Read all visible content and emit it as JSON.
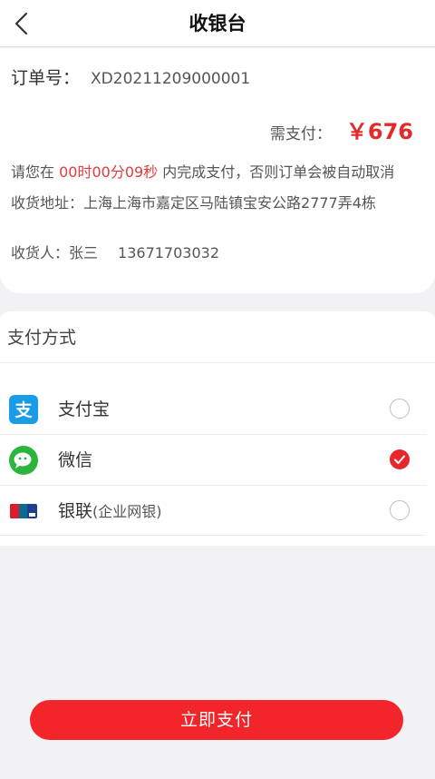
{
  "header": {
    "title": "收银台",
    "back_icon": "chevron-left-icon"
  },
  "order": {
    "number_label": "订单号：",
    "number": "XD20211209000001",
    "need_pay_label": "需支付：",
    "amount": "￥676",
    "deadline_prefix": "请您在 ",
    "countdown": "00时00分09秒",
    "deadline_suffix": " 内完成支付，否则订单会被自动取消",
    "address_label": "收货地址：",
    "address": "上海上海市嘉定区马陆镇宝安公路2777弄4栋",
    "receiver_label": "收货人：",
    "receiver_name": "张三",
    "receiver_phone": "13671703032"
  },
  "payment": {
    "title": "支付方式",
    "options": [
      {
        "label": "支付宝",
        "sub": "",
        "icon": "alipay-icon",
        "selected": false
      },
      {
        "label": "微信",
        "sub": "",
        "icon": "wechat-icon",
        "selected": true
      },
      {
        "label": "银联",
        "sub": "(企业网银)",
        "icon": "unionpay-icon",
        "selected": false
      }
    ]
  },
  "actions": {
    "pay_now_label": "立即支付"
  },
  "colors": {
    "accent": "#f2252a",
    "price": "#e22a2a",
    "alipay": "#1a9be8",
    "wechat": "#2bb53c"
  }
}
